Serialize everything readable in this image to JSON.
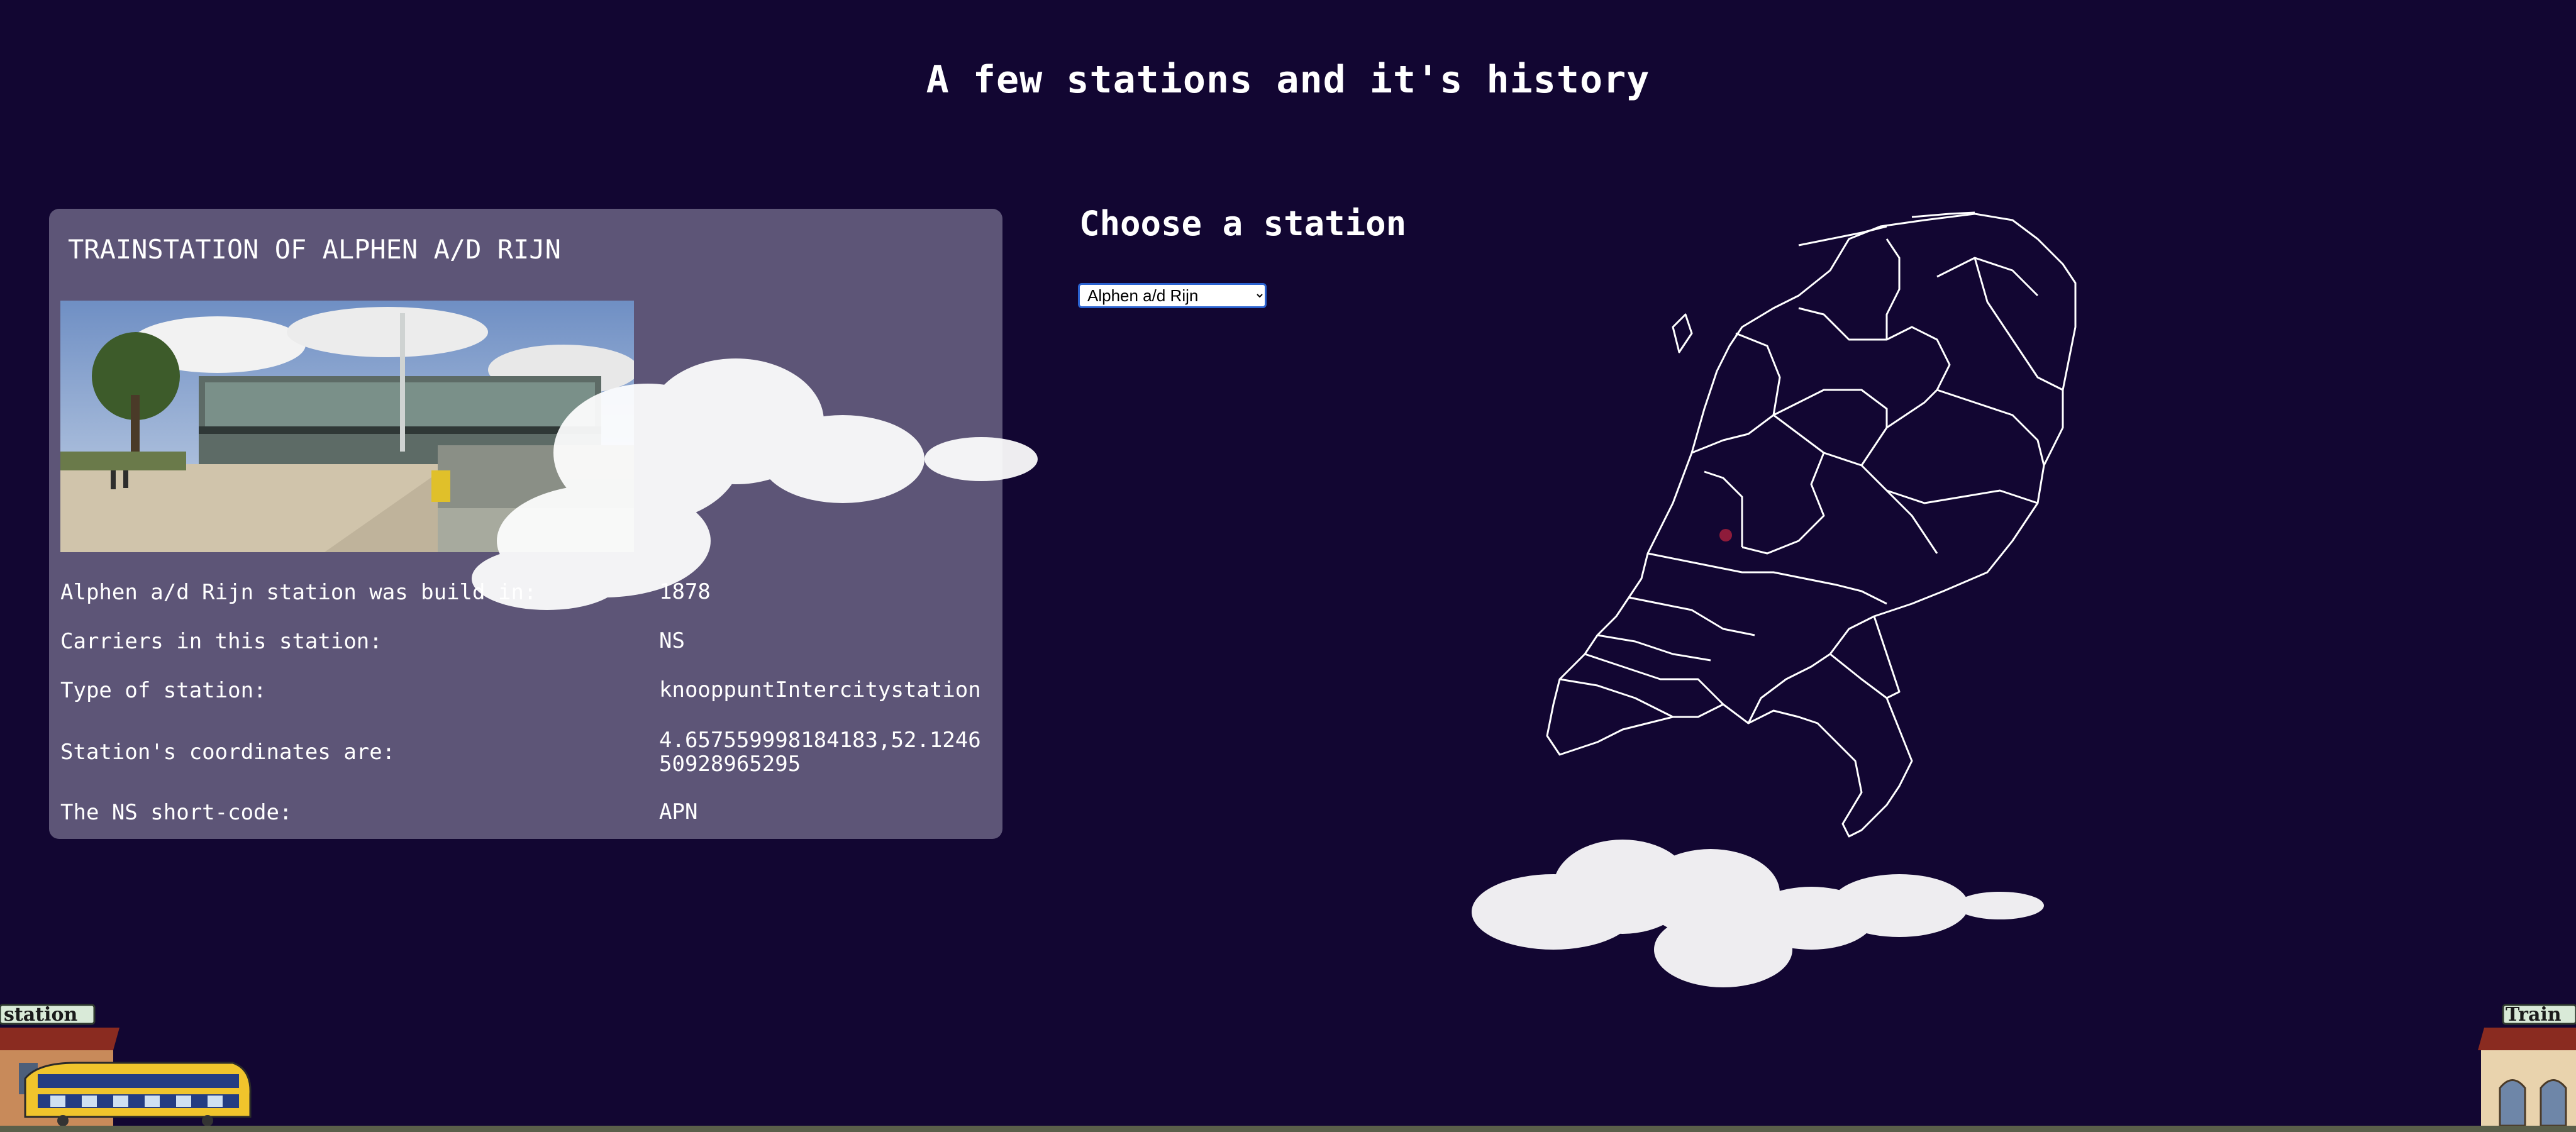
{
  "page": {
    "title": "A few stations and it's history",
    "background": "#120632"
  },
  "card": {
    "title": "TRAINSTATION OF ALPHEN A/D RIJN",
    "background": "#5d5577",
    "rows": [
      {
        "label": "Alphen a/d Rijn station was build in:",
        "value": "1878"
      },
      {
        "label": "Carriers in this station:",
        "value": "NS"
      },
      {
        "label": "Type of station:",
        "value": "knooppuntIntercitystation"
      },
      {
        "label": "Station's coordinates are:",
        "value": "4.657559998184183,52.124650928965295"
      },
      {
        "label": "The NS short-code:",
        "value": "APN"
      }
    ]
  },
  "chooser": {
    "title": "Choose a station",
    "selected": "Alphen a/d Rijn"
  },
  "map": {
    "outline_color": "#ffffff",
    "marker_color": "#8e1b3a"
  },
  "signs": {
    "left": "station",
    "right": "Train"
  }
}
